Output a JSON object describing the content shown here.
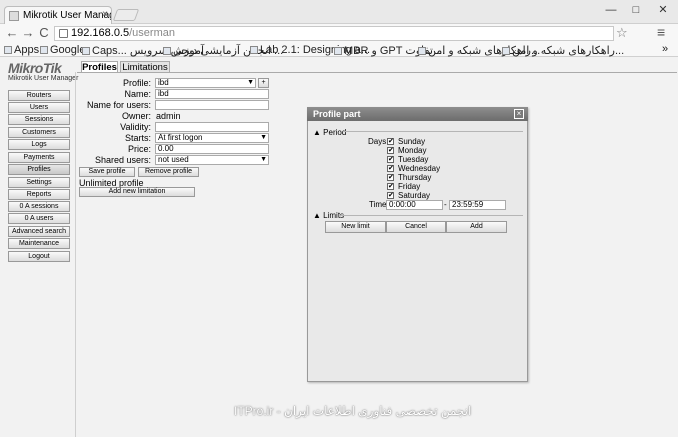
{
  "browser": {
    "tab_title": "Mikrotik User Manager: P",
    "tab_close": "×",
    "url_host": "192.168.0.5",
    "url_path": "/userman",
    "nav": {
      "back": "←",
      "forward": "→",
      "reload": "C"
    },
    "star": "☆",
    "menu": "≡",
    "window_controls": {
      "min": "—",
      "max": "□",
      "close": "✕"
    },
    "bookmarks": [
      "Apps",
      "Google",
      "Caps... آموزش سرویس",
      "انجمن آزمایشی دیجی ...",
      "Lab 2.1: Designing a...",
      "MBR و GPT تفاوت ...",
      "راهکارهای شبکه و امن...",
      "راهکارهای شبکه و امن..."
    ],
    "bookmarks_more": "»"
  },
  "app": {
    "logo_main": "MikroTik",
    "logo_sub": "Mikrotik User Manager",
    "sidebar": [
      "Routers",
      "Users",
      "Sessions",
      "Customers",
      "Logs",
      "Payments",
      "Profiles",
      "Settings",
      "Reports",
      "0 A sessions",
      "0 A users",
      "Advanced search",
      "Maintenance",
      "Logout"
    ],
    "sidebar_active_index": 6,
    "tabs": [
      "Profiles",
      "Limitations"
    ],
    "active_tab": "Profiles",
    "form": {
      "profile_label": "Profile:",
      "profile_value": "ibd",
      "profile_add": "+",
      "name_label": "Name:",
      "name_value": "ibd",
      "name_for_users_label": "Name for users:",
      "name_for_users_value": "",
      "owner_label": "Owner:",
      "owner_value": "admin",
      "validity_label": "Validity:",
      "validity_value": "",
      "starts_label": "Starts:",
      "starts_value": "At first logon",
      "price_label": "Price:",
      "price_value": "0.00",
      "shared_users_label": "Shared users:",
      "shared_users_value": "not used",
      "save_button": "Save profile",
      "remove_button": "Remove profile",
      "unlimited_text": "Unlimited profile",
      "add_limitation_button": "Add new limitation"
    }
  },
  "dialog": {
    "title": "Profile part",
    "close": "×",
    "period_label": "Period",
    "days_label": "Days:",
    "days": [
      "Sunday",
      "Monday",
      "Tuesday",
      "Wednesday",
      "Thursday",
      "Friday",
      "Saturday"
    ],
    "days_checked": [
      true,
      true,
      true,
      true,
      true,
      true,
      true
    ],
    "check_mark": "✔",
    "collapse_mark": "▲",
    "time_label": "Time:",
    "time_from": "0:00:00",
    "time_sep": "-",
    "time_to": "23:59:59",
    "limits_label": "Limits",
    "new_limit_button": "New limit",
    "cancel_button": "Cancel",
    "add_button": "Add"
  },
  "watermark": "ITPro.ir - انجمن تخصصی فناوری اطلاعات ایران",
  "colors": {
    "dialog_header": "#7d7d7d",
    "background": "#f2f2f2"
  }
}
